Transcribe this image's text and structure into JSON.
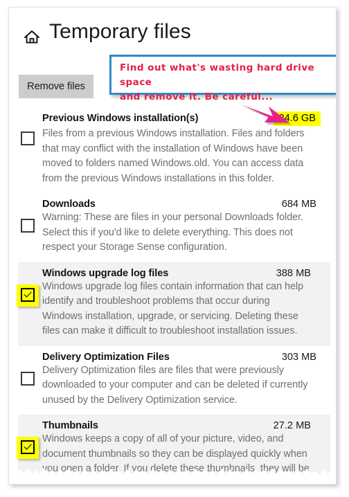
{
  "header": {
    "home_icon": "home-icon",
    "title": "Temporary files"
  },
  "toolbar": {
    "remove_files_label": "Remove files"
  },
  "annotation": {
    "callout_text": "Find out what's wasting hard drive space\nand remove it. Be careful...",
    "callout_border_color": "#2E8BC8",
    "callout_text_color": "#E32245",
    "arrow_color": "#E81F8C",
    "highlight_color": "#FFFF00"
  },
  "items": [
    {
      "title": "Previous Windows installation(s)",
      "size": "24.6 GB",
      "size_highlighted": true,
      "checked": false,
      "shaded": false,
      "description": "Files from a previous Windows installation.  Files and folders that may conflict with the installation of Windows have been moved to folders named Windows.old.  You can access data from the previous Windows installations in this folder."
    },
    {
      "title": "Downloads",
      "size": "684 MB",
      "size_highlighted": false,
      "checked": false,
      "shaded": false,
      "description": "Warning: These are files in your personal Downloads folder. Select this if you'd like to delete everything. This does not respect your Storage Sense configuration."
    },
    {
      "title": "Windows upgrade log files",
      "size": "388 MB",
      "size_highlighted": false,
      "checked": true,
      "shaded": true,
      "description": "Windows upgrade log files contain information that can help identify and troubleshoot problems that occur during Windows installation, upgrade, or servicing.  Deleting these files can make it difficult to troubleshoot installation issues."
    },
    {
      "title": "Delivery Optimization Files",
      "size": "303 MB",
      "size_highlighted": false,
      "checked": false,
      "shaded": false,
      "description": "Delivery Optimization files are files that were previously downloaded to your computer and can be deleted if currently unused by the Delivery Optimization service."
    },
    {
      "title": "Thumbnails",
      "size": "27.2 MB",
      "size_highlighted": false,
      "checked": true,
      "shaded": true,
      "description": "Windows keeps a copy of all of your picture, video, and document thumbnails so they can be displayed quickly when you open a folder. If you delete these thumbnails, they will be automatically recreated as needed."
    }
  ]
}
